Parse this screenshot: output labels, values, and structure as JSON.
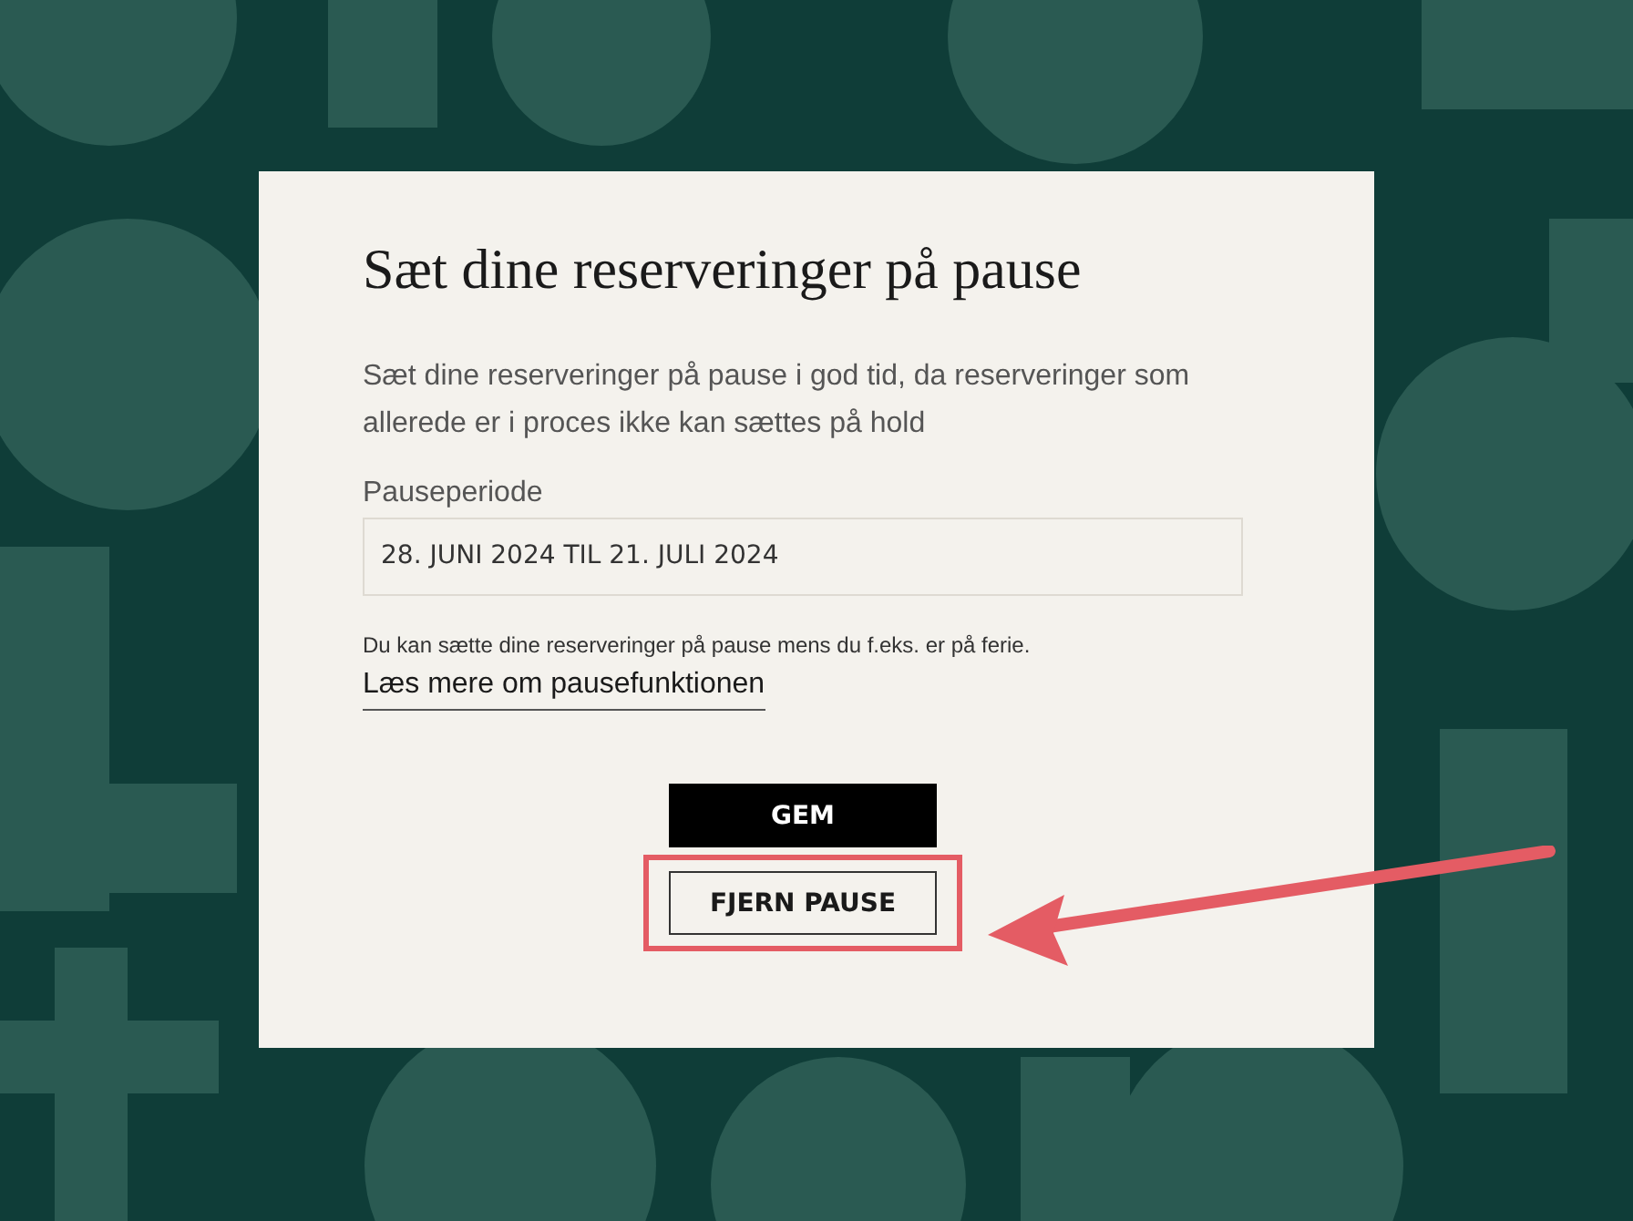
{
  "dialog": {
    "title": "Sæt dine reserveringer på pause",
    "description": "Sæt dine reserveringer på pause i god tid, da reserveringer som allerede er i proces ikke kan sættes på hold",
    "field": {
      "label": "Pauseperiode",
      "value": "28. JUNI 2024 TIL 21. JULI 2024"
    },
    "hint": "Du kan sætte dine reserveringer på pause mens du f.eks. er på ferie.",
    "link": "Læs mere om pausefunktionen",
    "buttons": [
      {
        "label": "GEM",
        "kind": "primary",
        "highlighted": false
      },
      {
        "label": "FJERN PAUSE",
        "kind": "secondary",
        "highlighted": true
      }
    ]
  }
}
